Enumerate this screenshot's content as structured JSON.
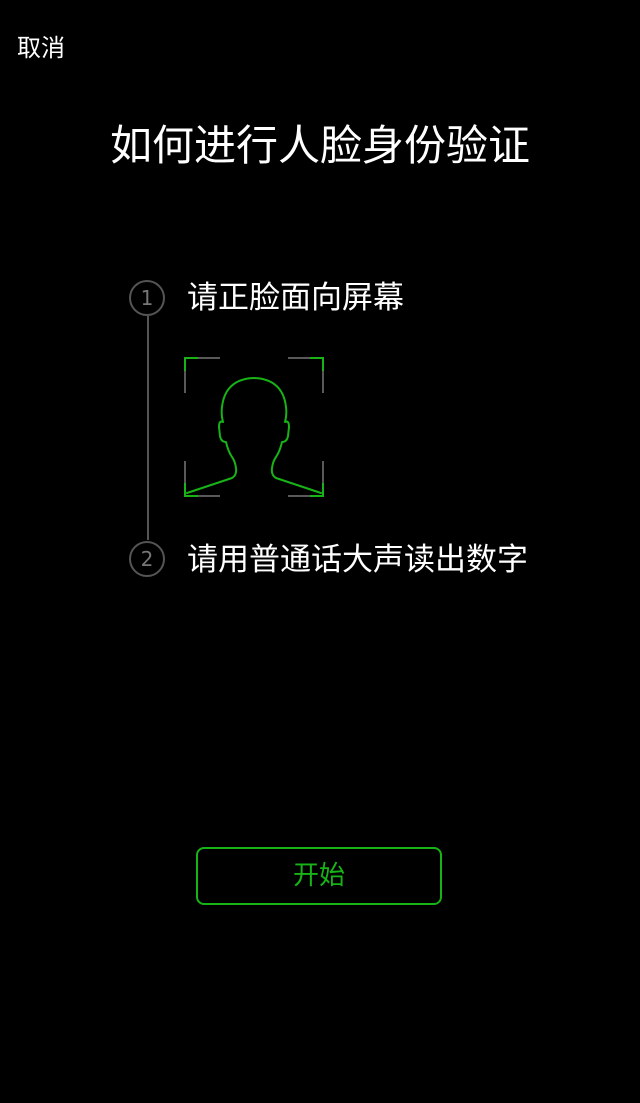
{
  "header": {
    "cancel_label": "取消"
  },
  "title": "如何进行人脸身份验证",
  "steps": [
    {
      "number": "1",
      "label": "请正脸面向屏幕"
    },
    {
      "number": "2",
      "label": "请用普通话大声读出数字"
    }
  ],
  "icons": {
    "face_guide": "face-outline-in-scan-frame-icon"
  },
  "action": {
    "start_label": "开始"
  },
  "colors": {
    "background": "#000000",
    "text": "#ffffff",
    "accent_green": "#17b317",
    "timeline_gray": "#555555"
  }
}
